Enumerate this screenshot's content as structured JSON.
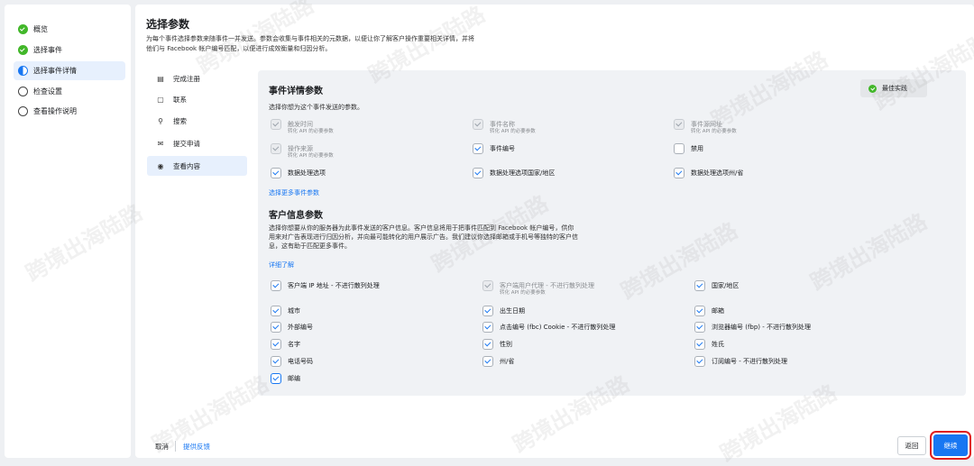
{
  "steps": [
    {
      "label": "概览",
      "state": "done"
    },
    {
      "label": "选择事件",
      "state": "done"
    },
    {
      "label": "选择事件详情",
      "state": "current"
    },
    {
      "label": "检查设置",
      "state": "todo"
    },
    {
      "label": "查看操作说明",
      "state": "todo"
    }
  ],
  "header": {
    "title": "选择参数",
    "desc": "为每个事件选择参数来随事件一并发送。参数会收集与事件相关的元数据，以便让你了解客户操作重要相关详情，并将他们与 Facebook 帐户编号匹配，以便进行成效衡量和归因分析。"
  },
  "menu": [
    {
      "label": "完成注册",
      "icon": "document-icon",
      "glyph": "▤"
    },
    {
      "label": "联系",
      "icon": "chat-icon",
      "glyph": "▢"
    },
    {
      "label": "搜索",
      "icon": "search-icon",
      "glyph": "⚲"
    },
    {
      "label": "提交申请",
      "icon": "mail-icon",
      "glyph": "✉"
    },
    {
      "label": "查看内容",
      "icon": "eye-icon",
      "glyph": "◉"
    }
  ],
  "event_section": {
    "title": "事件详情参数",
    "subtitle": "选择你想为这个事件发送的参数。",
    "best_practice": "最佳实践",
    "more_link": "选择更多事件参数",
    "params": [
      {
        "label": "触发时间",
        "hint": "转化 API 的必要参数",
        "checked": true,
        "disabled": true
      },
      {
        "label": "事件名称",
        "hint": "转化 API 的必要参数",
        "checked": true,
        "disabled": true
      },
      {
        "label": "事件源网址",
        "hint": "转化 API 的必要参数",
        "checked": true,
        "disabled": true
      },
      {
        "label": "操作来源",
        "hint": "转化 API 的必要参数",
        "checked": true,
        "disabled": true
      },
      {
        "label": "事件编号",
        "hint": "",
        "checked": true,
        "disabled": false
      },
      {
        "label": "禁用",
        "hint": "",
        "checked": false,
        "disabled": false
      },
      {
        "label": "数据处理选项",
        "hint": "",
        "checked": true,
        "disabled": false
      },
      {
        "label": "数据处理选项国家/地区",
        "hint": "",
        "checked": true,
        "disabled": false
      },
      {
        "label": "数据处理选项州/省",
        "hint": "",
        "checked": true,
        "disabled": false
      }
    ]
  },
  "customer_section": {
    "title": "客户信息参数",
    "desc": "选择你想要从你的服务器为此事件发送的客户信息。客户信息将用于把事件匹配到 Facebook 帐户编号，供你用来对广告表现进行归因分析，并向最可能转化的用户展示广告。我们建议你选择邮箱或手机号等独特的客户信息，这有助于匹配更多事件。",
    "learn_more": "详细了解",
    "params": [
      {
        "label": "客户端 IP 地址 - 不进行散列处理",
        "hint": "",
        "checked": true,
        "disabled": false
      },
      {
        "label": "客户端用户代理 - 不进行散列处理",
        "hint": "转化 API 的必要参数",
        "checked": true,
        "disabled": true
      },
      {
        "label": "国家/地区",
        "hint": "",
        "checked": true,
        "disabled": false
      },
      {
        "label": "城市",
        "hint": "",
        "checked": true,
        "disabled": false
      },
      {
        "label": "出生日期",
        "hint": "",
        "checked": true,
        "disabled": false
      },
      {
        "label": "邮箱",
        "hint": "",
        "checked": true,
        "disabled": false
      },
      {
        "label": "外部编号",
        "hint": "",
        "checked": true,
        "disabled": false
      },
      {
        "label": "点击编号 (fbc) Cookie - 不进行散列处理",
        "hint": "",
        "checked": true,
        "disabled": false
      },
      {
        "label": "浏览器编号 (fbp) - 不进行散列处理",
        "hint": "",
        "checked": true,
        "disabled": false
      },
      {
        "label": "名字",
        "hint": "",
        "checked": true,
        "disabled": false
      },
      {
        "label": "性别",
        "hint": "",
        "checked": true,
        "disabled": false
      },
      {
        "label": "姓氏",
        "hint": "",
        "checked": true,
        "disabled": false
      },
      {
        "label": "电话号码",
        "hint": "",
        "checked": true,
        "disabled": false
      },
      {
        "label": "州/省",
        "hint": "",
        "checked": true,
        "disabled": false
      },
      {
        "label": "订阅编号 - 不进行散列处理",
        "hint": "",
        "checked": true,
        "disabled": false
      },
      {
        "label": "邮编",
        "hint": "",
        "checked": true,
        "disabled": false,
        "focused": true
      }
    ]
  },
  "footer": {
    "cancel": "取消",
    "feedback": "提供反馈",
    "back": "返回",
    "continue": "继续"
  },
  "watermark": "跨境出海陆路",
  "colors": {
    "accent": "#1877f2",
    "success": "#42b72a",
    "highlight": "#e02020"
  }
}
